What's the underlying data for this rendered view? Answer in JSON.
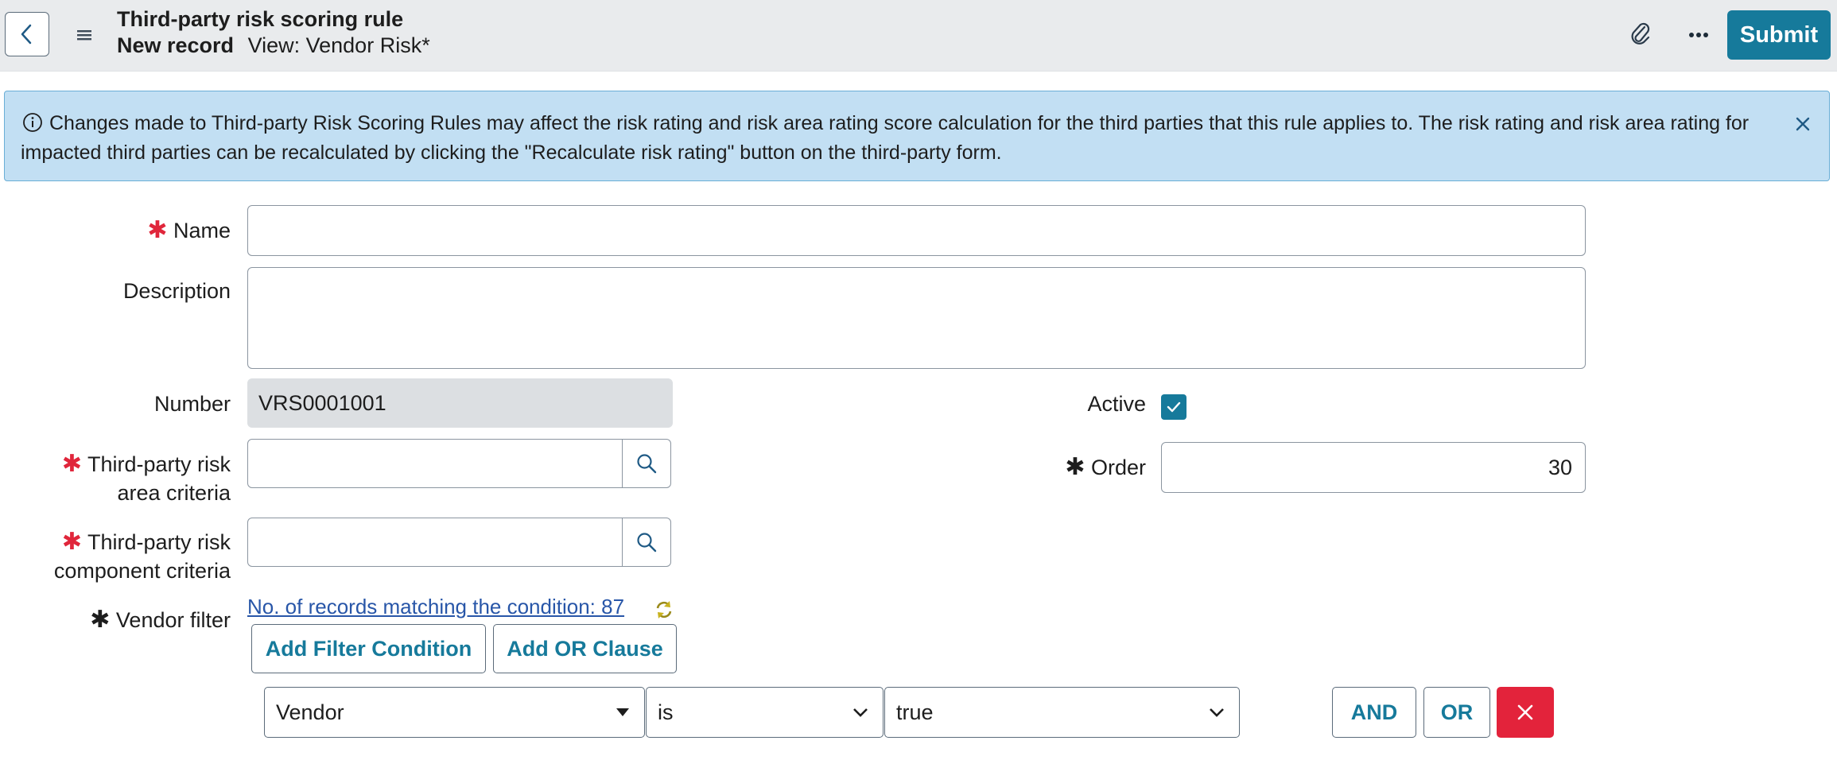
{
  "header": {
    "title": "Third-party risk scoring rule",
    "record_state": "New record",
    "view_label": "View: Vendor Risk*",
    "submit_label": "Submit"
  },
  "banner": {
    "text": "Changes made to Third-party Risk Scoring Rules may affect the risk rating and risk area rating score calculation for the third parties that this rule applies to. The risk rating and risk area rating for impacted third parties can be recalculated by clicking the \"Recalculate risk rating\" button on the third-party form."
  },
  "form": {
    "name_label": "Name",
    "name_value": "",
    "description_label": "Description",
    "description_value": "",
    "number_label": "Number",
    "number_value": "VRS0001001",
    "active_label": "Active",
    "active_checked": true,
    "area_label_line1": "Third-party risk",
    "area_label_line2": "area criteria",
    "area_value": "",
    "component_label_line1": "Third-party risk",
    "component_label_line2": "component criteria",
    "component_value": "",
    "order_label": "Order",
    "order_value": "30",
    "vendor_filter_label": "Vendor filter",
    "records_link": "No. of records matching the condition: 87",
    "add_filter_label": "Add Filter Condition",
    "add_or_label": "Add OR Clause"
  },
  "filter_row": {
    "field": "Vendor",
    "operator": "is",
    "value": "true",
    "and_label": "AND",
    "or_label": "OR"
  },
  "colors": {
    "accent": "#167a9b",
    "required": "#e0263b",
    "banner_bg": "#c2dff3",
    "delete": "#e3233b"
  },
  "icons": [
    "back-icon",
    "menu-icon",
    "paperclip-icon",
    "more-icon",
    "info-icon",
    "close-icon",
    "search-icon",
    "checkmark-icon",
    "refresh-icon",
    "chevron-down-icon",
    "delete-icon"
  ]
}
